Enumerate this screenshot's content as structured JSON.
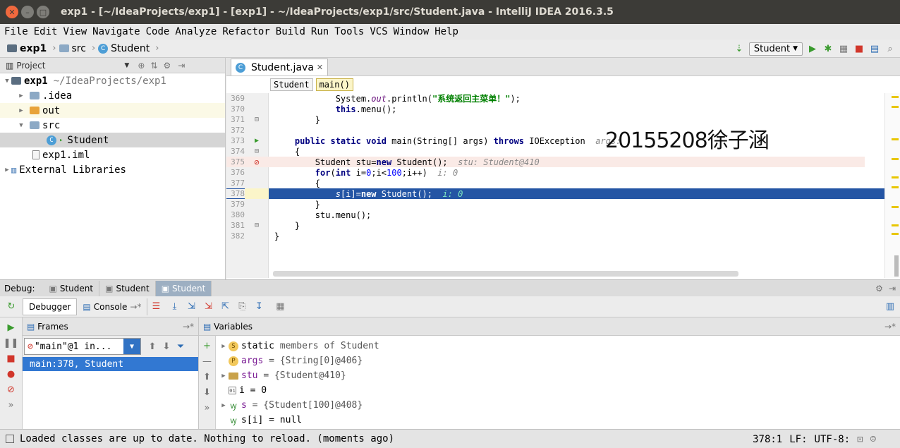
{
  "window": {
    "title": "exp1 - [~/IdeaProjects/exp1] - [exp1] - ~/IdeaProjects/exp1/src/Student.java - IntelliJ IDEA 2016.3.5"
  },
  "menu": [
    "File",
    "Edit",
    "View",
    "Navigate",
    "Code",
    "Analyze",
    "Refactor",
    "Build",
    "Run",
    "Tools",
    "VCS",
    "Window",
    "Help"
  ],
  "nav": {
    "crumbs": [
      "exp1",
      "src",
      "Student"
    ],
    "run_config": "Student"
  },
  "project": {
    "header": "Project",
    "tree": [
      {
        "label": "exp1",
        "suffix": "~/IdeaProjects/exp1",
        "bold": true
      },
      {
        "label": ".idea"
      },
      {
        "label": "out"
      },
      {
        "label": "src"
      },
      {
        "label": "Student"
      },
      {
        "label": "exp1.iml"
      },
      {
        "label": "External Libraries"
      }
    ]
  },
  "editor": {
    "tab": "Student.java",
    "breadcrumbs": [
      "Student",
      "main()"
    ],
    "overlay_text": "20155208徐子涵",
    "lines": [
      {
        "n": "369"
      },
      {
        "n": "370"
      },
      {
        "n": "371"
      },
      {
        "n": "372"
      },
      {
        "n": "373"
      },
      {
        "n": "374"
      },
      {
        "n": "375"
      },
      {
        "n": "376"
      },
      {
        "n": "377"
      },
      {
        "n": "378"
      },
      {
        "n": "379"
      },
      {
        "n": "380"
      },
      {
        "n": "381"
      },
      {
        "n": "382"
      }
    ],
    "code": {
      "l369_a": "            System.",
      "l369_b": "out",
      "l369_c": ".println(",
      "l369_d": "\"系统返回主菜单！\"",
      "l369_e": ");",
      "l370_a": "            ",
      "l370_kw": "this",
      "l370_b": ".menu();",
      "l371": "        }",
      "l373_a": "    ",
      "l373_kw": "public static void",
      "l373_b": " main(String[] args) ",
      "l373_kw2": "throws",
      "l373_c": " IOException",
      "l373_hint": "args:",
      "l374": "    {",
      "l375_a": "        Student stu=",
      "l375_kw": "new",
      "l375_b": " Student();",
      "l375_hint": "stu: Student@410",
      "l376_a": "        ",
      "l376_kw": "for",
      "l376_b": "(",
      "l376_kw2": "int",
      "l376_c": " i=",
      "l376_n1": "0",
      "l376_d": ";i<",
      "l376_n2": "100",
      "l376_e": ";i++)",
      "l376_hint": "i: 0",
      "l377": "        {",
      "l378_a": "            ",
      "l378_f": "s",
      "l378_b": "[i]=",
      "l378_kw": "new",
      "l378_c": " Student();",
      "l378_hint": "i: 0",
      "l379": "        }",
      "l380": "        stu.menu();",
      "l381": "    }",
      "l382": "}"
    }
  },
  "debug": {
    "label": "Debug:",
    "tabs": [
      "Student",
      "Student",
      "Student"
    ],
    "subtabs": {
      "debugger": "Debugger",
      "console": "Console"
    },
    "frames_header": "Frames",
    "variables_header": "Variables",
    "thread": "\"main\"@1 in...",
    "frame_row": "main:378, Student",
    "variables": [
      {
        "name": "static",
        "value": "members of Student",
        "icon": "s"
      },
      {
        "name": "args",
        "value": "= {String[0]@406}",
        "icon": "p"
      },
      {
        "name": "stu",
        "value": "= {Student@410}",
        "icon": "o"
      },
      {
        "name": "i",
        "value": "= 0",
        "icon": "prim"
      },
      {
        "name": "s",
        "value": "= {Student[100]@408}",
        "icon": "w"
      },
      {
        "name": "s[i]",
        "value": "= null",
        "icon": "w"
      }
    ]
  },
  "status": {
    "message": "Loaded classes are up to date. Nothing to reload. (moments ago)",
    "position": "378:1",
    "line_sep": "LF:",
    "encoding": "UTF-8:"
  },
  "colors": {
    "selection": "#2455a4",
    "breakpoint_line": "#faeae6",
    "accent": "#3278d2"
  }
}
